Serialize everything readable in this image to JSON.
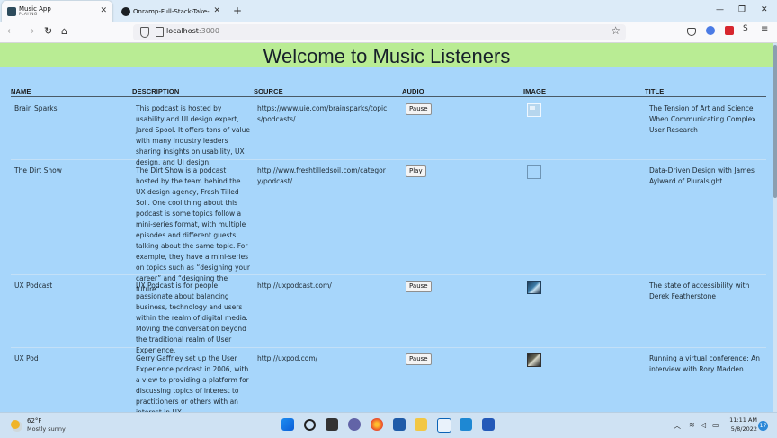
{
  "browser": {
    "tabs": [
      {
        "title": "Music App",
        "subtitle": "PLAYING"
      },
      {
        "title": "Onramp-Full-Stack-Take-Home"
      }
    ],
    "url_host": "localhost",
    "url_port": ":3000"
  },
  "page": {
    "heading": "Welcome to Music Listeners",
    "columns": [
      "NAME",
      "DESCRIPTION",
      "SOURCE",
      "AUDIO",
      "IMAGE",
      "TITLE"
    ],
    "rows": [
      {
        "name": "Brain Sparks",
        "description": "This podcast is hosted by usability and UI design expert, Jared Spool. It offers tons of value with many industry leaders sharing insights on usability, UX design, and UI design.",
        "source": "https://www.uie.com/brainsparks/topics/podcasts/",
        "audio_button": "Pause",
        "title": "The Tension of Art and Science When Communicating Complex User Research"
      },
      {
        "name": "The Dirt Show",
        "description": "The Dirt Show is a podcast hosted by the team behind the UX design agency, Fresh Tilled Soil. One cool thing about this podcast is some topics follow a mini-series format, with multiple episodes and different guests talking about the same topic. For example, they have a mini-series on topics such as “designing your career” and “designing the future”.",
        "source": "http://www.freshtilledsoil.com/category/podcast/",
        "audio_button": "Play",
        "title": "Data-Driven Design with James Aylward of Pluralsight"
      },
      {
        "name": "UX Podcast",
        "description": "UX Podcast is for people passionate about balancing business, technology and users within the realm of digital media. Moving the conversation beyond the traditional realm of User Experience.",
        "source": "http://uxpodcast.com/",
        "audio_button": "Pause",
        "title": "The state of accessibility with Derek Featherstone"
      },
      {
        "name": "UX Pod",
        "description": "Gerry Gaffney set up the User Experience podcast in 2006, with a view to providing a platform for discussing topics of interest to practitioners or others with an interest in UX.",
        "source": "http://uxpod.com/",
        "audio_button": "Pause",
        "title": "Running a virtual conference: An interview with Rory Madden"
      }
    ]
  },
  "taskbar": {
    "weather_temp": "62°F",
    "weather_desc": "Mostly sunny",
    "time": "11:11 AM",
    "date": "5/8/2022",
    "notification_count": "17"
  },
  "colors": {
    "page_bg": "#a7d6fb",
    "banner_bg": "#b9ec94"
  }
}
